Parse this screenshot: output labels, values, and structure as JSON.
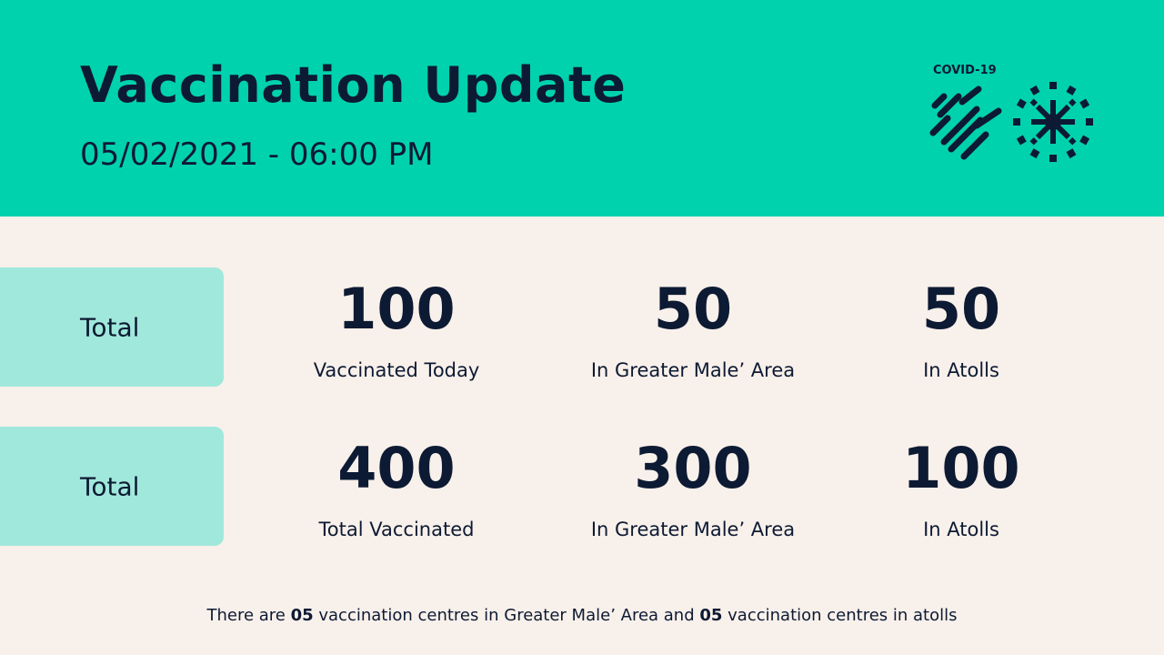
{
  "header": {
    "title": "Vaccination Update",
    "datetime": "05/02/2021 - 06:00 PM",
    "logo_text": "COVID-19",
    "logo_icon": "vaccine-virus-logo-icon",
    "background_color": "#00d2ae"
  },
  "rows": [
    {
      "label": "Total",
      "stats": [
        {
          "value": "100",
          "label": "Vaccinated Today"
        },
        {
          "value": "50",
          "label": "In Greater Male’ Area"
        },
        {
          "value": "50",
          "label": "In Atolls"
        }
      ]
    },
    {
      "label": "Total",
      "stats": [
        {
          "value": "400",
          "label": "Total Vaccinated"
        },
        {
          "value": "300",
          "label": "In Greater Male’ Area"
        },
        {
          "value": "100",
          "label": "In Atolls"
        }
      ]
    }
  ],
  "footer": {
    "part1": "There are ",
    "count1": "05",
    "part2": " vaccination centres in Greater Male’ Area and ",
    "count2": "05",
    "part3": " vaccination centres in atolls"
  },
  "colors": {
    "accent": "#00d2ae",
    "label_bg": "#a1e8dc",
    "page_bg": "#f8f0ea",
    "text": "#0d1a33"
  }
}
